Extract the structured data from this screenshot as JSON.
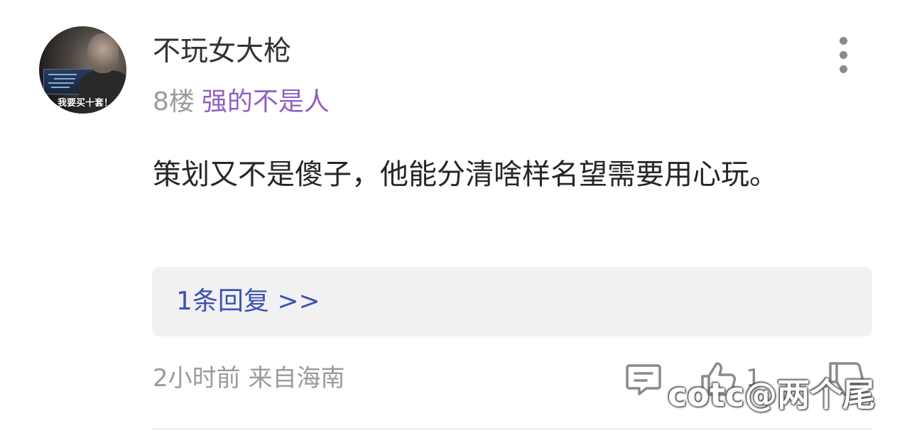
{
  "post": {
    "username": "不玩女大枪",
    "floor": "8楼",
    "user_title": "强的不是人",
    "content": "策划又不是傻子，他能分清啥样名望需要用心玩。",
    "reply_link": "1条回复 >>",
    "time_location": "2小时前 来自海南",
    "like_count": "1",
    "avatar_caption": "我要买十套！"
  },
  "icons": {
    "comment": "comment-icon",
    "like": "thumbs-up-icon",
    "dislike": "thumbs-down-icon",
    "more": "more-vertical-icon"
  },
  "watermark": "@两个尾",
  "colors": {
    "title_purple": "#8f5fc3",
    "link_blue": "#3d52b3",
    "meta_gray": "#9b9b9b",
    "reply_bg": "#f1f1f1"
  }
}
